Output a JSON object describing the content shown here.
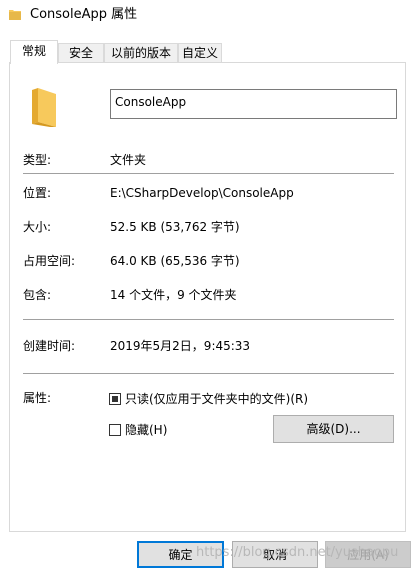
{
  "window": {
    "title": "ConsoleApp 属性",
    "icon": "folder-icon"
  },
  "tabs": [
    {
      "label": "常规",
      "active": true
    },
    {
      "label": "安全",
      "active": false
    },
    {
      "label": "以前的版本",
      "active": false
    },
    {
      "label": "自定义",
      "active": false
    }
  ],
  "general": {
    "name_value": "ConsoleApp",
    "type_label": "类型:",
    "type_value": "文件夹",
    "location_label": "位置:",
    "location_value": "E:\\CSharpDevelop\\ConsoleApp",
    "size_label": "大小:",
    "size_value": "52.5 KB (53,762 字节)",
    "size_on_disk_label": "占用空间:",
    "size_on_disk_value": "64.0 KB (65,536 字节)",
    "contains_label": "包含:",
    "contains_value": "14 个文件，9 个文件夹",
    "created_label": "创建时间:",
    "created_value": "2019年5月2日，9:45:33",
    "attributes_label": "属性:",
    "readonly_label": "只读(仅应用于文件夹中的文件)(R)",
    "readonly_state": "mixed",
    "hidden_label": "隐藏(H)",
    "hidden_state": "unchecked",
    "advanced_button": "高级(D)..."
  },
  "footer": {
    "ok_button": "确定",
    "cancel_button": "取消",
    "apply_button": "应用(A)",
    "watermark": "https://blog.csdn.net/yushaopu"
  },
  "colors": {
    "accent": "#0078d7",
    "folder": "#f7c95c"
  }
}
